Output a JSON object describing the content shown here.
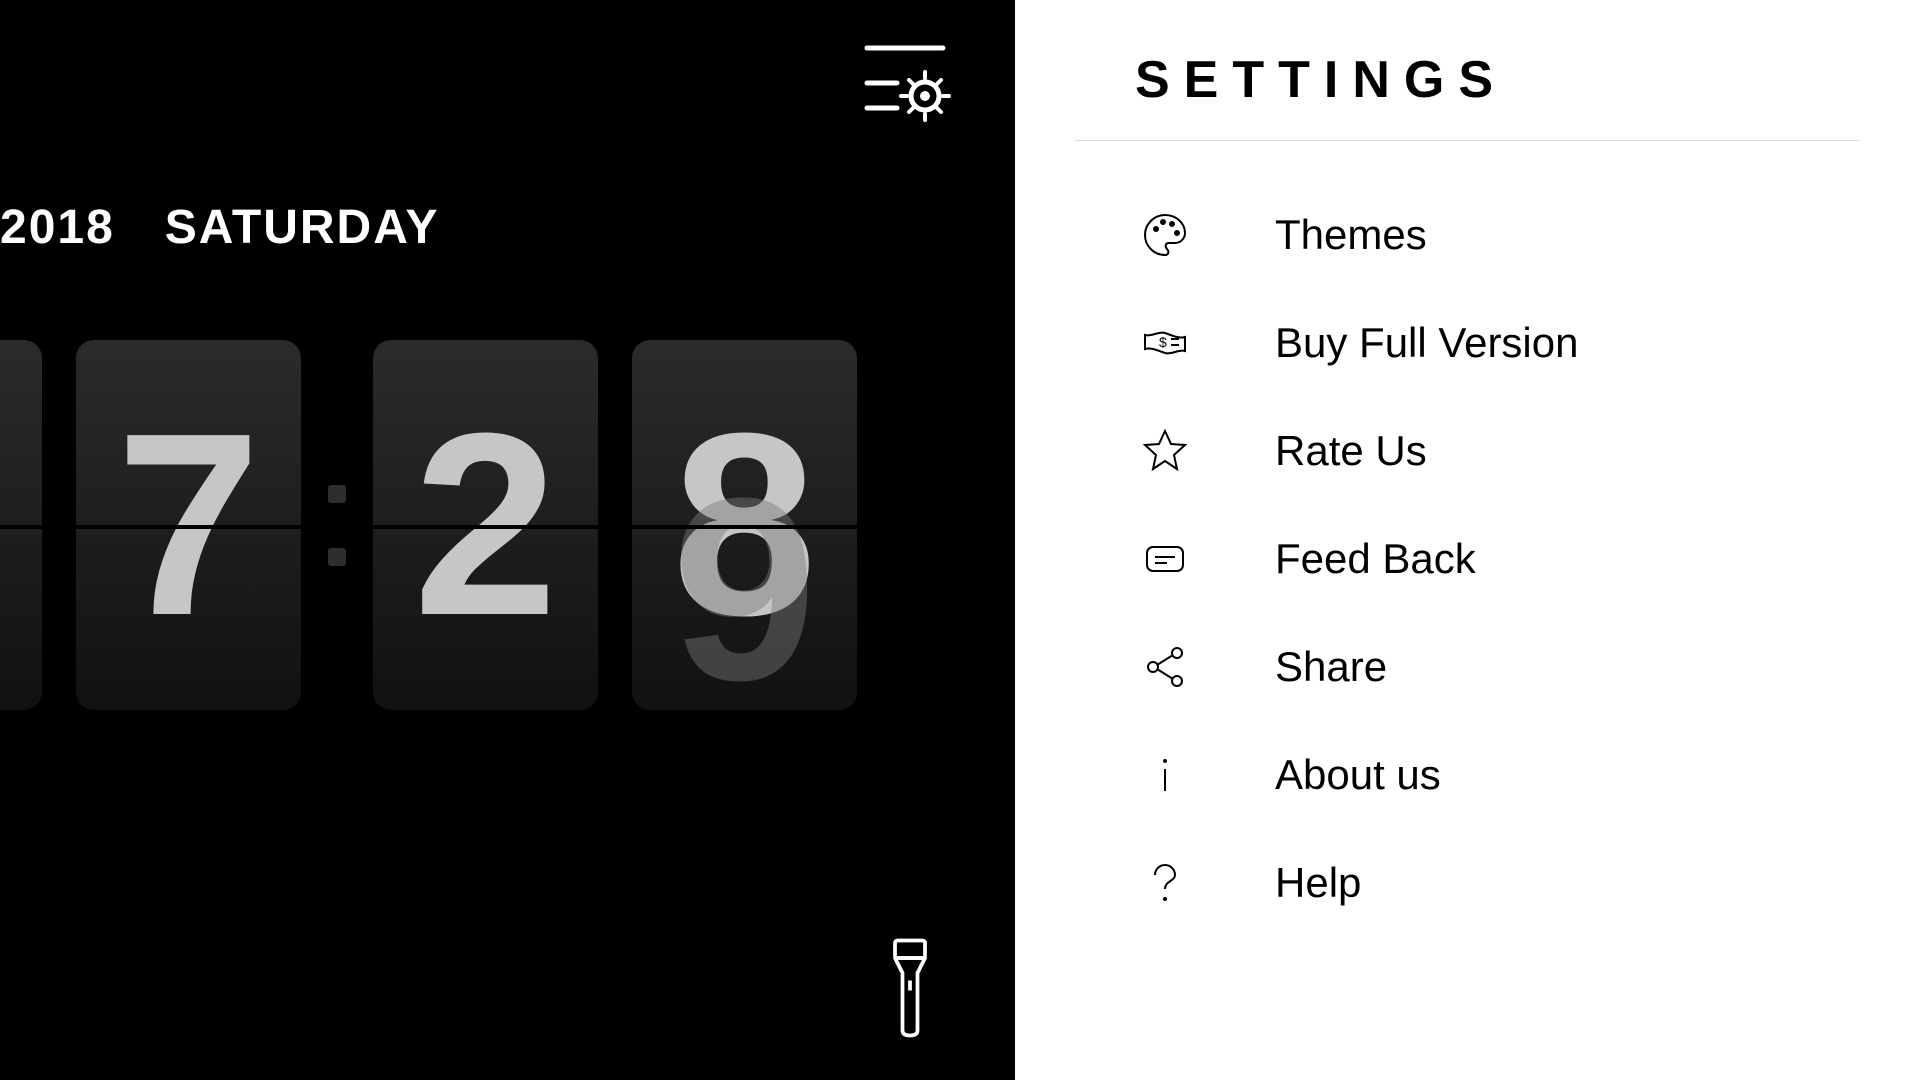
{
  "clock": {
    "year": "2018",
    "day_of_week": "SATURDAY",
    "digits": [
      "",
      "7",
      "2",
      "8"
    ],
    "last_digit_ghost": "9"
  },
  "settings": {
    "title": "SETTINGS",
    "items": [
      {
        "icon": "palette",
        "label": "Themes"
      },
      {
        "icon": "money",
        "label": "Buy Full Version"
      },
      {
        "icon": "star",
        "label": "Rate Us"
      },
      {
        "icon": "feedback",
        "label": "Feed Back"
      },
      {
        "icon": "share",
        "label": "Share"
      },
      {
        "icon": "info",
        "label": "About us"
      },
      {
        "icon": "help",
        "label": "Help"
      }
    ]
  }
}
